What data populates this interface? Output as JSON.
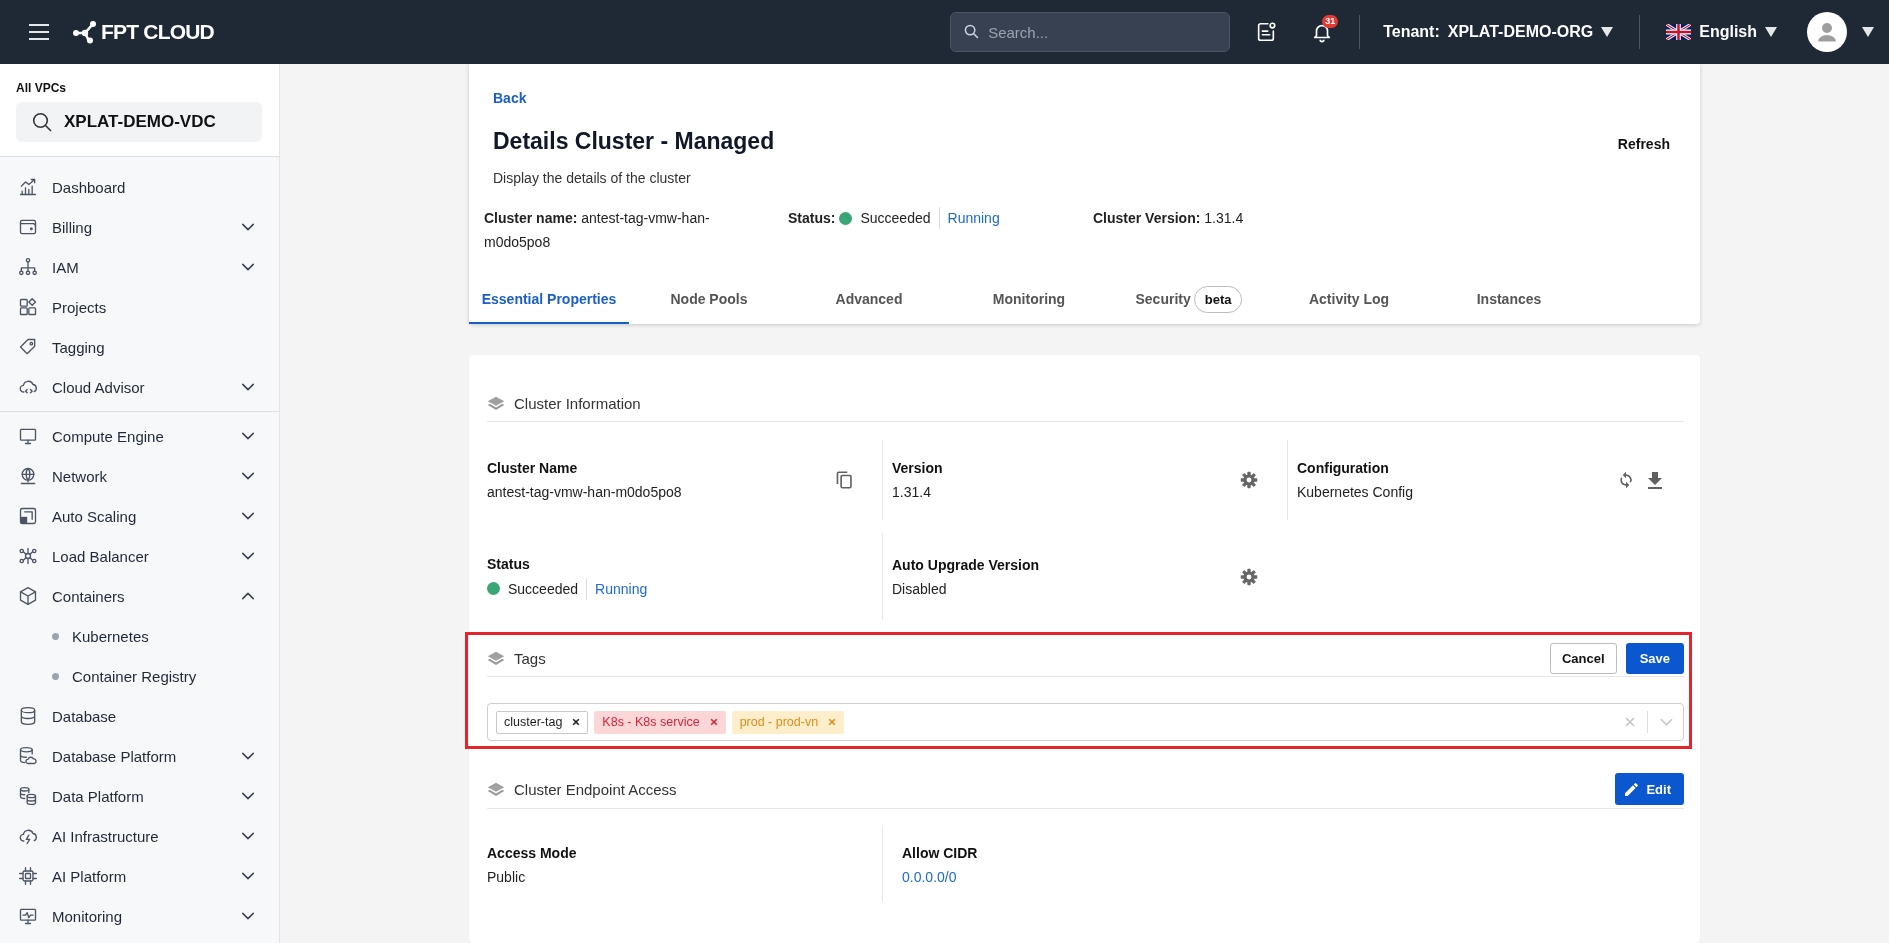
{
  "topbar": {
    "logo": "FPT CLOUD",
    "search": {
      "placeholder": "Search..."
    },
    "notification_count": "31",
    "tenant": {
      "label": "Tenant:",
      "value": "XPLAT-DEMO-ORG"
    },
    "language": "English"
  },
  "sidebar": {
    "vpc_label": "All VPCs",
    "vpc_selector": "XPLAT-DEMO-VDC",
    "sections": [
      {
        "items": [
          {
            "label": "Dashboard",
            "kind": "link"
          },
          {
            "label": "Billing",
            "kind": "menu",
            "expanded": false
          },
          {
            "label": "IAM",
            "kind": "menu",
            "expanded": false
          },
          {
            "label": "Projects",
            "kind": "link"
          },
          {
            "label": "Tagging",
            "kind": "link"
          },
          {
            "label": "Cloud Advisor",
            "kind": "menu",
            "expanded": false
          }
        ]
      },
      {
        "items": [
          {
            "label": "Compute Engine",
            "kind": "menu",
            "expanded": false
          },
          {
            "label": "Network",
            "kind": "menu",
            "expanded": false
          },
          {
            "label": "Auto Scaling",
            "kind": "menu",
            "expanded": false
          },
          {
            "label": "Load Balancer",
            "kind": "menu",
            "expanded": false
          },
          {
            "label": "Containers",
            "kind": "menu",
            "expanded": true,
            "children": [
              {
                "label": "Kubernetes"
              },
              {
                "label": "Container Registry"
              }
            ]
          },
          {
            "label": "Database",
            "kind": "link"
          },
          {
            "label": "Database Platform",
            "kind": "menu",
            "expanded": false
          },
          {
            "label": "Data Platform",
            "kind": "menu",
            "expanded": false
          },
          {
            "label": "AI Infrastructure",
            "kind": "menu",
            "expanded": false
          },
          {
            "label": "AI Platform",
            "kind": "menu",
            "expanded": false
          },
          {
            "label": "Monitoring",
            "kind": "menu",
            "expanded": false
          }
        ]
      }
    ]
  },
  "header": {
    "back": "Back",
    "title": "Details Cluster - Managed",
    "subtitle": "Display the details of the cluster",
    "refresh": "Refresh",
    "summary": {
      "cluster_name": "**Cluster name:** antest-tag-vmw-han-m0do5po8",
      "status": {
        "label": "Status:",
        "value": "Succeeded",
        "phase": "Running"
      },
      "version": "**Cluster Version:** 1.31.4"
    }
  },
  "tabs": [
    {
      "label": "Essential Properties",
      "selected": true
    },
    {
      "label": "Node Pools",
      "selected": false
    },
    {
      "label": "Advanced",
      "selected": false
    },
    {
      "label": "Monitoring",
      "selected": false
    },
    {
      "label": "Security",
      "selected": false,
      "badge": "beta"
    },
    {
      "label": "Activity Log",
      "selected": false
    },
    {
      "label": "Instances",
      "selected": false
    }
  ],
  "cluster_info": {
    "title": "Cluster Information",
    "fields": [
      {
        "label": "Cluster Name",
        "kind": "text",
        "value": "antest-tag-vmw-han-m0do5po8"
      },
      {
        "label": "Version",
        "kind": "text",
        "value": "1.31.4"
      },
      {
        "label": "Configuration",
        "kind": "text",
        "value": "Kubernetes Config"
      },
      {
        "label": "Status",
        "kind": "status",
        "value": "Succeeded",
        "phase": "Running"
      },
      {
        "label": "Auto Upgrade Version",
        "kind": "text",
        "value": "Disabled"
      }
    ]
  },
  "tags": {
    "title": "Tags",
    "highlighted": true,
    "cancel": "Cancel",
    "save": "Save",
    "items": [
      {
        "label": "cluster-tag",
        "color": "#ffffff"
      },
      {
        "label": "K8s - K8s service",
        "color": "#fdd6d8"
      },
      {
        "label": "prod - prod-vn",
        "color": "#ffeecb"
      }
    ]
  },
  "endpoint_access": {
    "title": "Cluster Endpoint Access",
    "edit": "Edit",
    "fields": [
      {
        "label": "Access Mode",
        "kind": "text",
        "value": "Public"
      },
      {
        "label": "Allow CIDR",
        "kind": "link",
        "value": "0.0.0.0/0"
      }
    ]
  }
}
